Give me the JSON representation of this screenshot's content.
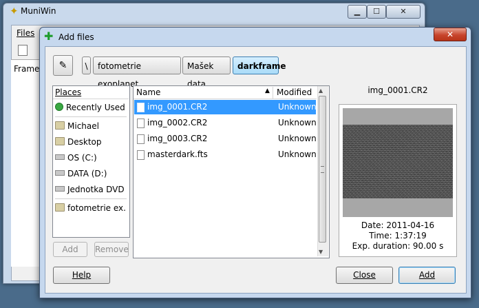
{
  "parent_window": {
    "title": "MuniWin",
    "menu_files": "Files",
    "frame_label": "Frame"
  },
  "dialog": {
    "title": "Add files",
    "path": [
      "\\",
      "fotometrie exoplanet",
      "Mašek data",
      "darkframe"
    ]
  },
  "places": {
    "header": "Places",
    "items": [
      {
        "label": "Recently Used",
        "icon": "recent-icon"
      },
      {
        "label": "Michael",
        "icon": "folder-icon"
      },
      {
        "label": "Desktop",
        "icon": "folder-icon"
      },
      {
        "label": "OS (C:)",
        "icon": "drive-icon"
      },
      {
        "label": "DATA (D:)",
        "icon": "drive-icon"
      },
      {
        "label": "Jednotka DVD ...",
        "icon": "drive-icon"
      },
      {
        "label": "fotometrie ex...",
        "icon": "folder-icon"
      }
    ],
    "add_label": "Add",
    "remove_label": "Remove"
  },
  "files": {
    "col_name": "Name",
    "col_modified": "Modified",
    "rows": [
      {
        "name": "img_0001.CR2",
        "modified": "Unknown",
        "selected": true
      },
      {
        "name": "img_0002.CR2",
        "modified": "Unknown",
        "selected": false
      },
      {
        "name": "img_0003.CR2",
        "modified": "Unknown",
        "selected": false
      },
      {
        "name": "masterdark.fts",
        "modified": "Unknown",
        "selected": false
      }
    ]
  },
  "preview": {
    "filename": "img_0001.CR2",
    "date": "Date: 2011-04-16",
    "time": "Time: 1:37:19",
    "exposure": "Exp. duration: 90.00 s"
  },
  "buttons": {
    "help": "Help",
    "close": "Close",
    "add": "Add"
  },
  "colors": {
    "selection": "#3399ff",
    "title_bar": "#c6d8ee",
    "close_button": "#c7442c"
  }
}
